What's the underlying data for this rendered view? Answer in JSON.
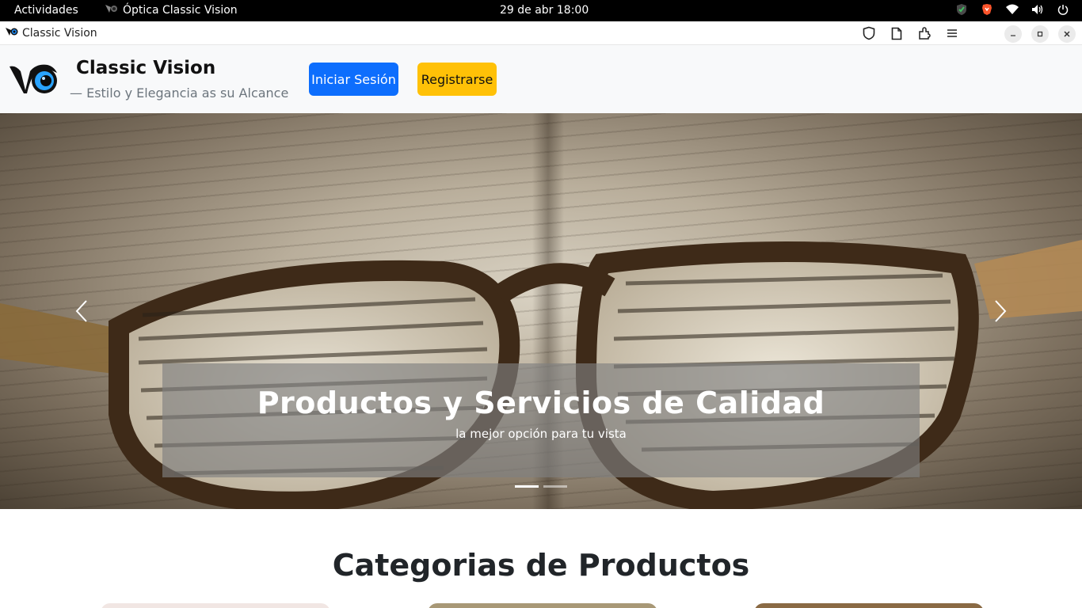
{
  "system": {
    "activities": "Actividades",
    "app_name": "Óptica Classic Vision",
    "clock": "29 de abr  18:00",
    "tray_icons": [
      "shield-check-icon",
      "brave-icon",
      "wifi-icon",
      "volume-icon",
      "power-icon"
    ]
  },
  "browser": {
    "tab_title": "Classic Vision",
    "tools": [
      "shield-icon",
      "page-icon",
      "extensions-icon",
      "menu-icon"
    ],
    "window_controls": [
      "minimize-icon",
      "maximize-icon",
      "close-icon"
    ]
  },
  "header": {
    "brand_name": "Classic Vision",
    "tagline": "— Estilo y Elegancia as su Alcance",
    "login_label": "Iniciar Sesión",
    "register_label": "Registrarse",
    "colors": {
      "login": "#0d6efd",
      "register": "#ffc107"
    }
  },
  "carousel": {
    "title": "Productos y Servicios de Calidad",
    "subtitle": "la mejor opción para tu vista",
    "slide_count": 2,
    "active_slide": 1
  },
  "categories": {
    "title": "Categorias de Productos"
  }
}
